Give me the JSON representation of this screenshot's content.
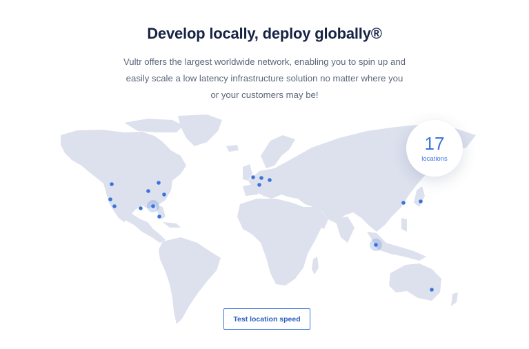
{
  "section": {
    "title": "Develop locally, deploy globally®",
    "description": "Vultr offers the largest worldwide network, enabling you to spin up and easily scale a low latency infrastructure solution no matter where you or your customers may be!"
  },
  "locations_badge": {
    "count": "17",
    "label": "locations"
  },
  "button": {
    "label": "Test location speed"
  },
  "colors": {
    "accent": "#3a74d9",
    "map_land": "#dde1ee",
    "title": "#162344",
    "body_text": "#5b667a"
  }
}
